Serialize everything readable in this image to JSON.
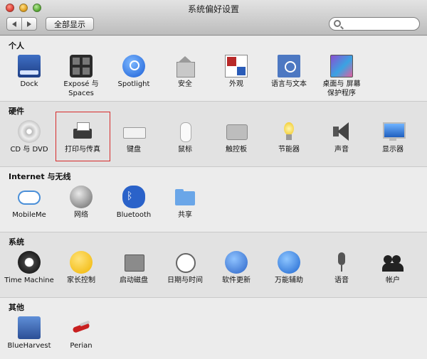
{
  "window": {
    "title": "系统偏好设置",
    "show_all_label": "全部显示",
    "search": {
      "value": "",
      "placeholder": ""
    }
  },
  "sections": [
    {
      "title": "个人",
      "items": [
        {
          "label": "Dock",
          "icon": "dock-icon"
        },
        {
          "label": "Exposé 与 Spaces",
          "icon": "expose-spaces-icon"
        },
        {
          "label": "Spotlight",
          "icon": "spotlight-icon"
        },
        {
          "label": "安全",
          "icon": "security-house-icon"
        },
        {
          "label": "外观",
          "icon": "appearance-icon"
        },
        {
          "label": "语言与文本",
          "icon": "language-text-icon"
        },
        {
          "label": "桌面与 屏幕保护程序",
          "icon": "desktop-screensaver-icon"
        }
      ]
    },
    {
      "title": "硬件",
      "items": [
        {
          "label": "CD 与 DVD",
          "icon": "cd-dvd-icon"
        },
        {
          "label": "打印与传真",
          "icon": "printer-fax-icon"
        },
        {
          "label": "键盘",
          "icon": "keyboard-icon"
        },
        {
          "label": "鼠标",
          "icon": "mouse-icon"
        },
        {
          "label": "触控板",
          "icon": "trackpad-icon"
        },
        {
          "label": "节能器",
          "icon": "energy-saver-icon"
        },
        {
          "label": "声音",
          "icon": "sound-icon"
        },
        {
          "label": "显示器",
          "icon": "display-icon"
        }
      ]
    },
    {
      "title": "Internet 与无线",
      "items": [
        {
          "label": "MobileMe",
          "icon": "mobileme-icon"
        },
        {
          "label": "网络",
          "icon": "network-globe-icon"
        },
        {
          "label": "Bluetooth",
          "icon": "bluetooth-icon"
        },
        {
          "label": "共享",
          "icon": "sharing-folder-icon"
        }
      ]
    },
    {
      "title": "系统",
      "items": [
        {
          "label": "Time Machine",
          "icon": "time-machine-icon"
        },
        {
          "label": "家长控制",
          "icon": "parental-controls-icon"
        },
        {
          "label": "启动磁盘",
          "icon": "startup-disk-icon"
        },
        {
          "label": "日期与时间",
          "icon": "date-time-icon"
        },
        {
          "label": "软件更新",
          "icon": "software-update-icon"
        },
        {
          "label": "万能辅助",
          "icon": "universal-access-icon"
        },
        {
          "label": "语音",
          "icon": "speech-microphone-icon"
        },
        {
          "label": "帐户",
          "icon": "accounts-icon"
        }
      ]
    },
    {
      "title": "其他",
      "items": [
        {
          "label": "BlueHarvest",
          "icon": "blueharvest-icon"
        },
        {
          "label": "Perian",
          "icon": "perian-icon"
        }
      ]
    }
  ]
}
